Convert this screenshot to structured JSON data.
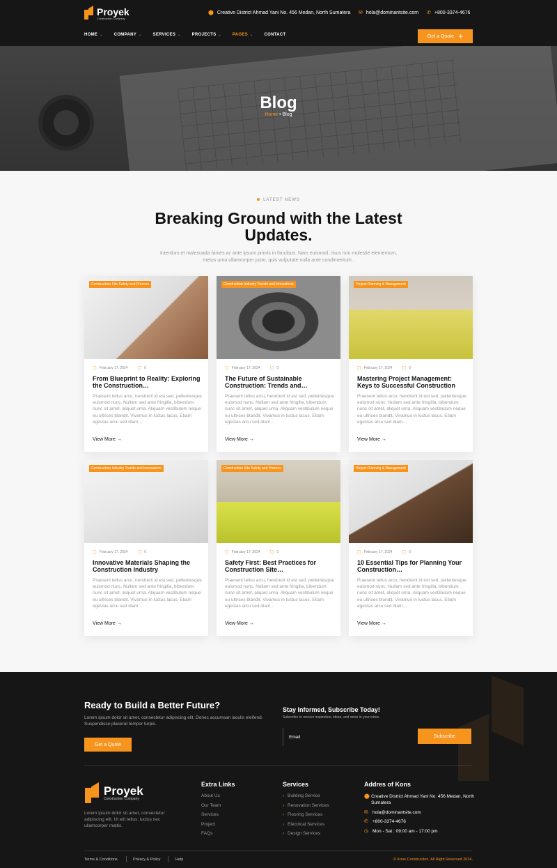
{
  "header": {
    "logo_name": "Proyek",
    "logo_sub": "Construction Company",
    "address": "Creative District Ahmad Yani No. 456 Medan, North Sumatera",
    "email": "hola@dominantsite.com",
    "phone": "+800-3374-4676",
    "nav": [
      {
        "label": "HOME"
      },
      {
        "label": "COMPANY"
      },
      {
        "label": "SERVICES"
      },
      {
        "label": "PROJECTS"
      },
      {
        "label": "PAGES"
      },
      {
        "label": "CONTACT"
      }
    ],
    "quote_label": "Get a Quote"
  },
  "hero": {
    "title": "Blog",
    "crumb_home": "Home",
    "crumb_sep": " • ",
    "crumb_current": "Blog"
  },
  "section": {
    "tag": "LATEST NEWS",
    "title": "Breaking Ground with the Latest Updates.",
    "description": "Interdum et malesuada fames ac ante ipsum primis in faucibus. Nam euismod, risus non molestie elementum, metus urna ullamcorper justo, quis vulputate nulla ante condimentum ."
  },
  "posts": [
    {
      "tag": "Construction Site Safety and Process",
      "date": "February 17, 2024",
      "comments": "0",
      "title": "From Blueprint to Reality: Exploring the Construction…",
      "excerpt": "Praesent tellus arcu, hendrerit id est sed, pellentesque euismod nunc. Nullam sed ante fringilla, bibendum nunc sit amet, aliquet urna. Aliquam vestibulum neque eu ultrices blandit. Vivamus in luctus lacus. Etiam egestas arcu sed diam…",
      "more": "View More →"
    },
    {
      "tag": "Construction Industry Trends and Innovations",
      "date": "February 17, 2024",
      "comments": "0",
      "title": "The Future of Sustainable Construction: Trends and…",
      "excerpt": "Praesent tellus arcu, hendrerit id est sed, pellentesque euismod nunc. Nullam sed ante fringilla, bibendum nunc sit amet, aliquet urna. Aliquam vestibulum neque eu ultrices blandit. Vivamus in luctus lacus. Etiam egestas arcu sed diam…",
      "more": "View More →"
    },
    {
      "tag": "Project Planning & Management",
      "date": "February 17, 2024",
      "comments": "0",
      "title": "Mastering Project Management: Keys to Successful Construction",
      "excerpt": "Praesent tellus arcu, hendrerit id est sed, pellentesque euismod nunc. Nullam sed ante fringilla, bibendum nunc sit amet, aliquet urna. Aliquam vestibulum neque eu ultrices blandit. Vivamus in luctus lacus. Etiam egestas arcu sed diam…",
      "more": "View More →"
    },
    {
      "tag": "Construction Industry Trends and Innovations",
      "date": "February 17, 2024",
      "comments": "0",
      "title": "Innovative Materials Shaping the Construction Industry",
      "excerpt": "Praesent tellus arcu, hendrerit id est sed, pellentesque euismod nunc. Nullam sed ante fringilla, bibendum nunc sit amet, aliquet urna. Aliquam vestibulum neque eu ultrices blandit. Vivamus in luctus lacus. Etiam egestas arcu sed diam…",
      "more": "View More →"
    },
    {
      "tag": "Construction Site Safety and Process",
      "date": "February 17, 2024",
      "comments": "0",
      "title": "Safety First: Best Practices for Construction Site…",
      "excerpt": "Praesent tellus arcu, hendrerit id est sed, pellentesque euismod nunc. Nullam sed ante fringilla, bibendum nunc sit amet, aliquet urna. Aliquam vestibulum neque eu ultrices blandit. Vivamus in luctus lacus. Etiam egestas arcu sed diam…",
      "more": "View More →"
    },
    {
      "tag": "Project Planning & Management",
      "date": "February 17, 2024",
      "comments": "0",
      "title": "10 Essential Tips for Planning Your Construction…",
      "excerpt": "Praesent tellus arcu, hendrerit id est sed, pellentesque euismod nunc. Nullam sed ante fringilla, bibendum nunc sit amet, aliquet urna. Aliquam vestibulum neque eu ultrices blandit. Vivamus in luctus lacus. Etiam egestas arcu sed diam…",
      "more": "View More →"
    }
  ],
  "footer": {
    "cta_title": "Ready to Build a Better Future?",
    "cta_desc": "Lorem ipsum dolor sit amet, consectetur adipiscing elit. Donec accumsan iaculis eleifend. Suspendisse placerat tempor turpis.",
    "cta_button": "Get a Quote",
    "subscribe_title": "Stay Informed, Subscribe Today!",
    "subscribe_desc": "Subscribe to receive inspiration, ideas, and news in your inbox.",
    "email_placeholder": "Email",
    "subscribe_button": "Subscribe",
    "about": "Lorem ipsum dolor sit amet, consectetur adipiscing elit. Ut elit tellus, luctus nec ullamcorper mattis.",
    "extra_title": "Extra Links",
    "extra_links": [
      "About Us",
      "Our Team",
      "Services",
      "Project",
      "FAQs"
    ],
    "services_title": "Services",
    "services": [
      "Building Service",
      "Renovation Services",
      "Flooring Services",
      "Electrical Services",
      "Design Services"
    ],
    "address_title": "Addres of Kons",
    "address": "Creative District Ahmad Yani No. 456 Medan, North Sumatera",
    "email": "hola@dominantsite.com",
    "phone": "+800-3374-4676",
    "hours": "Mon - Sat : 09:00 am - 17:00 pm",
    "bottom_links": [
      "Terms & Conditions",
      "Privacy & Policy",
      "Help"
    ],
    "copyright": "© Kons Construction. All Right Reserved 2024."
  },
  "colors": {
    "accent": "#f7941d",
    "dark": "#161616"
  }
}
